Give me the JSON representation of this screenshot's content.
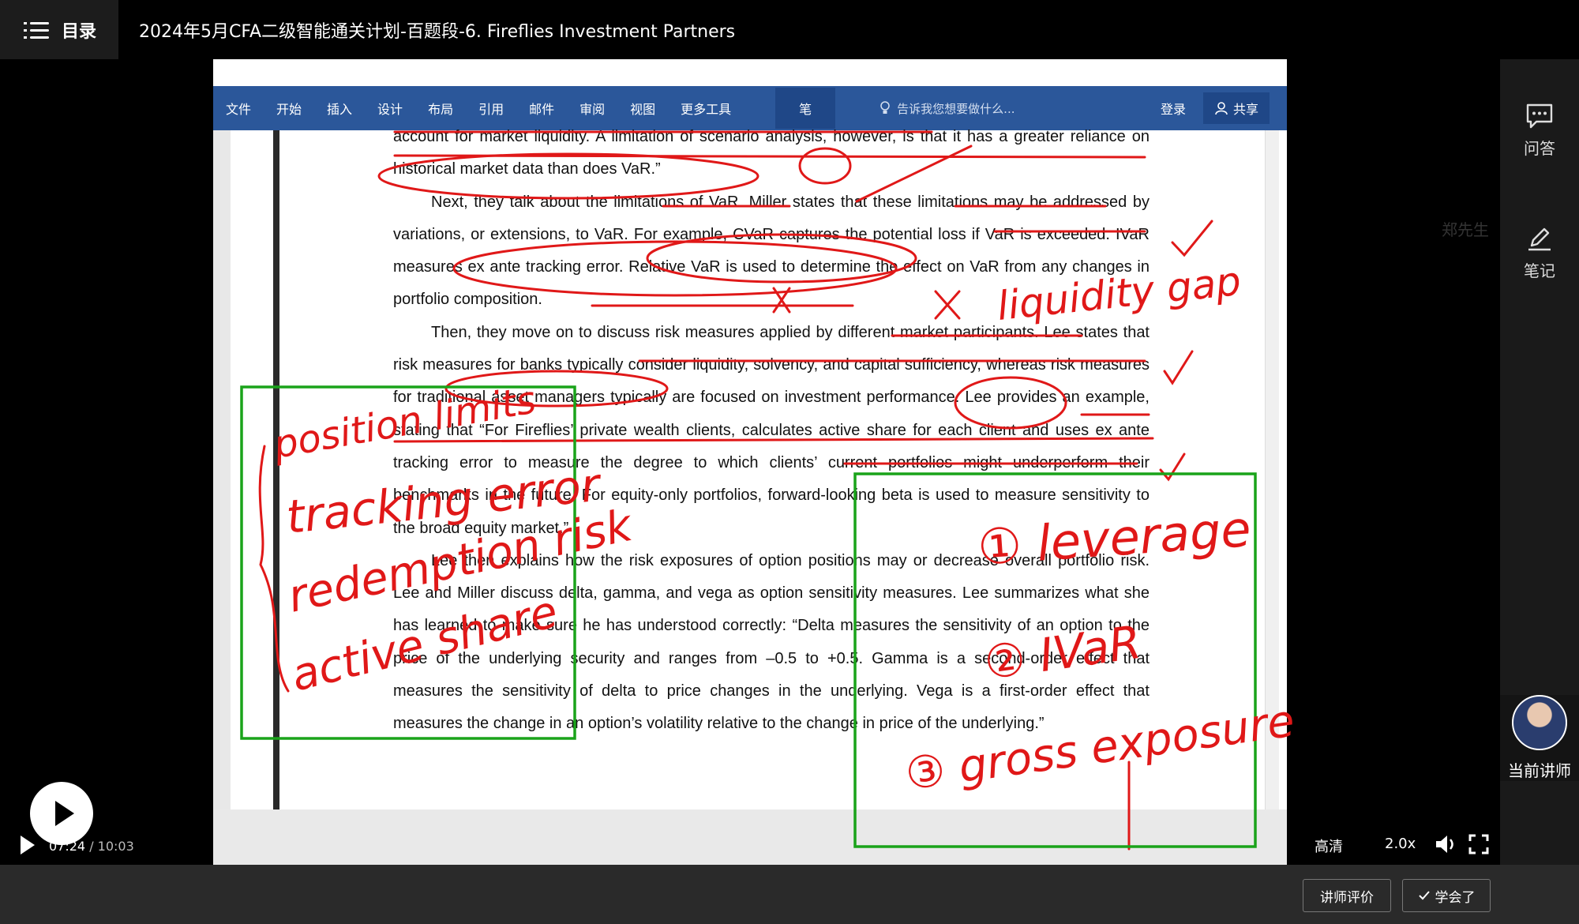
{
  "header": {
    "toc_label": "目录",
    "course_title": "2024年5月CFA二级智能通关计划-百题段-6. Fireflies Investment Partners"
  },
  "ribbon": {
    "tabs": [
      "文件",
      "开始",
      "插入",
      "设计",
      "布局",
      "引用",
      "邮件",
      "审阅",
      "视图",
      "更多工具"
    ],
    "pen_tab": "笔",
    "tell_me": "告诉我您想要做什么...",
    "login": "登录",
    "share": "共享"
  },
  "document": {
    "paragraphs": [
      "account for market liquidity. A limitation of scenario analysis, however, is that it has a greater reliance on historical market data than does VaR.”",
      "Next, they talk about the limitations of VaR. Miller states that these limitations may be addressed by variations, or extensions, to VaR. For example, CVaR captures the potential loss if VaR is exceeded. IVaR measures ex ante tracking error. Relative VaR is used to determine the effect on VaR from any changes in portfolio composition.",
      "Then, they move on to discuss risk measures applied by different market participants. Lee states that risk measures for banks typically consider liquidity, solvency, and capital sufficiency, whereas risk measures for traditional asset managers typically are focused on investment performance. Lee provides an example, stating that “For Fireflies’ private wealth clients, calculates active share for each client and uses ex ante tracking error to measure the degree to which clients’ current portfolios might underperform their benchmarks in the future. For equity-only portfolios, forward-looking beta is used to measure sensitivity to the broad equity market.”",
      "Lee then explains how the risk exposures of option positions may or decrease overall portfolio risk. Lee and Miller discuss delta, gamma, and vega as option sensitivity measures. Lee summarizes what she has learned to make sure he has understood correctly: “Delta measures the sensitivity of an option to the price of the underlying security and ranges from –0.5 to +0.5. Gamma is a second-order effect that measures the sensitivity of delta to price changes in the underlying. Vega is a first-order effect that measures the change in an option’s volatility relative to the change in price of the underlying.”"
    ]
  },
  "annotations": {
    "liquidity_gap": "liquidity gap",
    "left_box": [
      "position limits",
      "tracking error",
      "redemption risk",
      "active share"
    ],
    "right_box": [
      "① leverage",
      "② IVaR",
      "③ gross exposure"
    ]
  },
  "watermark": "郑先生",
  "player": {
    "current_time": "07:24",
    "separator": " / ",
    "total_time": "10:03",
    "progress_fraction": 0.7363,
    "quality": "高清",
    "speed": "2.0x"
  },
  "right_panel": {
    "qa_label": "问答",
    "note_label": "笔记",
    "teacher_label": "当前讲师"
  },
  "bottom": {
    "rate_label": "讲师评价",
    "learned_label": "学会了"
  },
  "colors": {
    "ribbon": "#2b579a",
    "ink_red": "#e01818",
    "box_green": "#1aa31a",
    "progress": "#23a3e0"
  }
}
